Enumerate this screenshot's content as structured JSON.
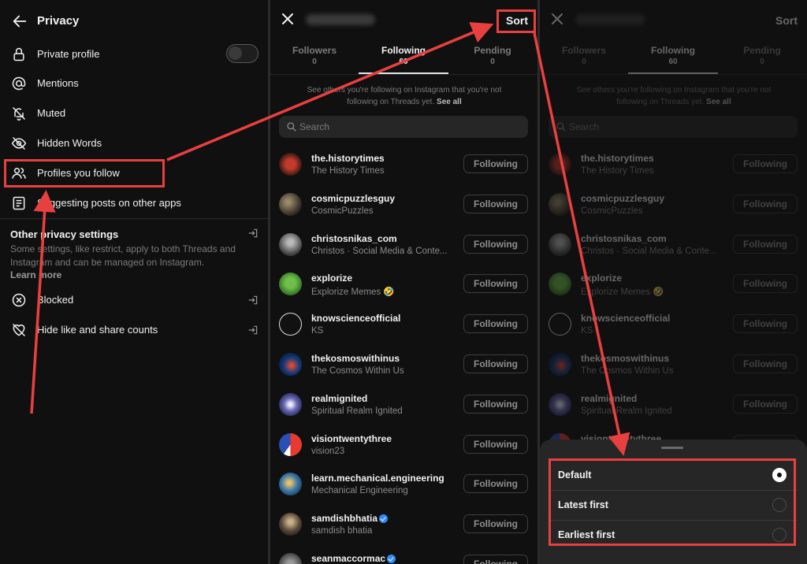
{
  "privacy": {
    "title": "Privacy",
    "items": [
      {
        "label": "Private profile",
        "icon": "lock-icon"
      },
      {
        "label": "Mentions",
        "icon": "at-icon"
      },
      {
        "label": "Muted",
        "icon": "bell-off-icon"
      },
      {
        "label": "Hidden Words",
        "icon": "eye-off-icon"
      },
      {
        "label": "Profiles you follow",
        "icon": "people-icon"
      },
      {
        "label": "Suggesting posts on other apps",
        "icon": "document-icon"
      }
    ],
    "private_profile_on": false,
    "other_title": "Other privacy settings",
    "other_desc": "Some settings, like restrict, apply to both Threads and Instagram and can be managed on Instagram.",
    "learn_more": "Learn more",
    "other_items": [
      {
        "label": "Blocked",
        "icon": "blocked-icon"
      },
      {
        "label": "Hide like and share counts",
        "icon": "heart-off-icon"
      }
    ]
  },
  "following_screen": {
    "sort_label": "Sort",
    "tabs": [
      {
        "label": "Followers",
        "count": "0"
      },
      {
        "label": "Following",
        "count": "60"
      },
      {
        "label": "Pending",
        "count": "0"
      }
    ],
    "info_text": "See others you're following on Instagram that you're not following on Threads yet.",
    "see_all": "See all",
    "search_placeholder": "Search",
    "button_label": "Following",
    "users": [
      {
        "username": "the.historytimes",
        "name": "The History Times",
        "verified": false
      },
      {
        "username": "cosmicpuzzlesguy",
        "name": "CosmicPuzzles",
        "verified": false
      },
      {
        "username": "christosnikas_com",
        "name": "Christos · Social Media & Conte...",
        "verified": false
      },
      {
        "username": "explorize",
        "name": "Explorize Memes 🤣",
        "verified": false
      },
      {
        "username": "knowscienceofficial",
        "name": "KS",
        "verified": false
      },
      {
        "username": "thekosmoswithinus",
        "name": "The Cosmos Within Us",
        "verified": false
      },
      {
        "username": "realmignited",
        "name": "Spiritual Realm Ignited",
        "verified": false
      },
      {
        "username": "visiontwentythree",
        "name": "vision23",
        "verified": false
      },
      {
        "username": "learn.mechanical.engineering",
        "name": "Mechanical Engineering",
        "verified": false
      },
      {
        "username": "samdishbhatia",
        "name": "samdish bhatia",
        "verified": true
      },
      {
        "username": "seanmaccormac",
        "name": "",
        "verified": true
      }
    ]
  },
  "sort_sheet": {
    "options": [
      {
        "label": "Default",
        "selected": true
      },
      {
        "label": "Latest first",
        "selected": false
      },
      {
        "label": "Earliest first",
        "selected": false
      }
    ]
  },
  "colors": {
    "background": "#101010",
    "annotation_red": "#e8403f",
    "verified_blue": "#2f8cff"
  }
}
